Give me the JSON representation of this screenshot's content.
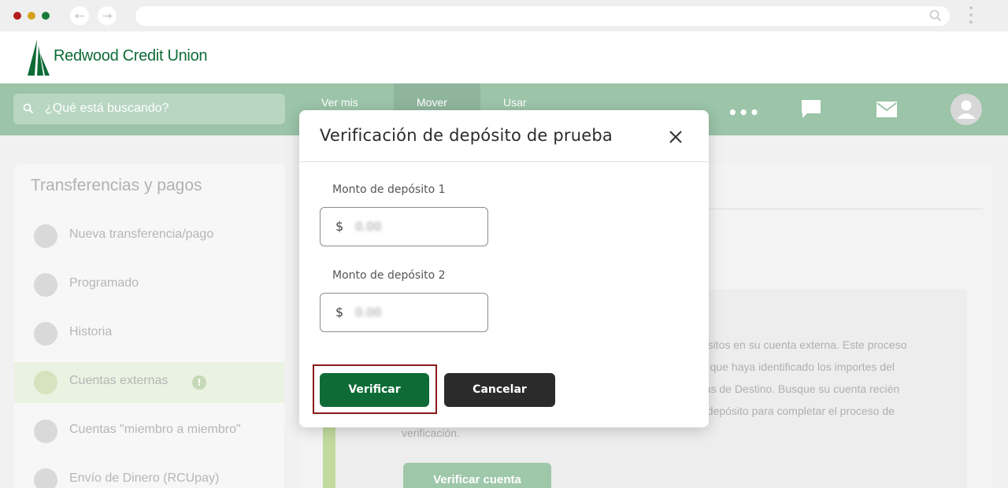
{
  "browser": {
    "back_icon": "arrow-left-icon",
    "forward_icon": "arrow-right-icon",
    "url": ""
  },
  "site": {
    "brand": "Redwood Credit Union"
  },
  "topnav": {
    "search_placeholder": "¿Qué está buscando?",
    "links": [
      "Ver mis",
      "Mover",
      "Usar"
    ],
    "more_label": "•••"
  },
  "sidebar": {
    "title": "Transferencias y pagos",
    "items": [
      {
        "label": "Nueva transferencia/pago"
      },
      {
        "label": "Programado"
      },
      {
        "label": "Historia"
      },
      {
        "label": "Cuentas externas"
      },
      {
        "label": "Cuentas \"miembro a miembro\""
      },
      {
        "label": "Envío de Dinero (RCUpay)"
      }
    ],
    "alert_badge": "!"
  },
  "main": {
    "info_lines": [
      "pósitos en su cuenta externa. Este proceso",
      "ez que haya identificado los importes del",
      "ntas de Destino. Busque su cuenta recién",
      "el depósito para completar el proceso de",
      "verificación."
    ],
    "verify_account_label": "Verificar cuenta"
  },
  "modal": {
    "title": "Verificación de depósito de prueba",
    "field1_label": "Monto de depósito 1",
    "field2_label": "Monto de depósito 2",
    "currency": "$",
    "field1_placeholder": "0.00",
    "field2_placeholder": "0.00",
    "verify_label": "Verificar",
    "cancel_label": "Cancelar"
  },
  "colors": {
    "brand_green": "#0e6b36",
    "nav_green": "#9bc4a8",
    "highlight": "#8b1a1a"
  }
}
